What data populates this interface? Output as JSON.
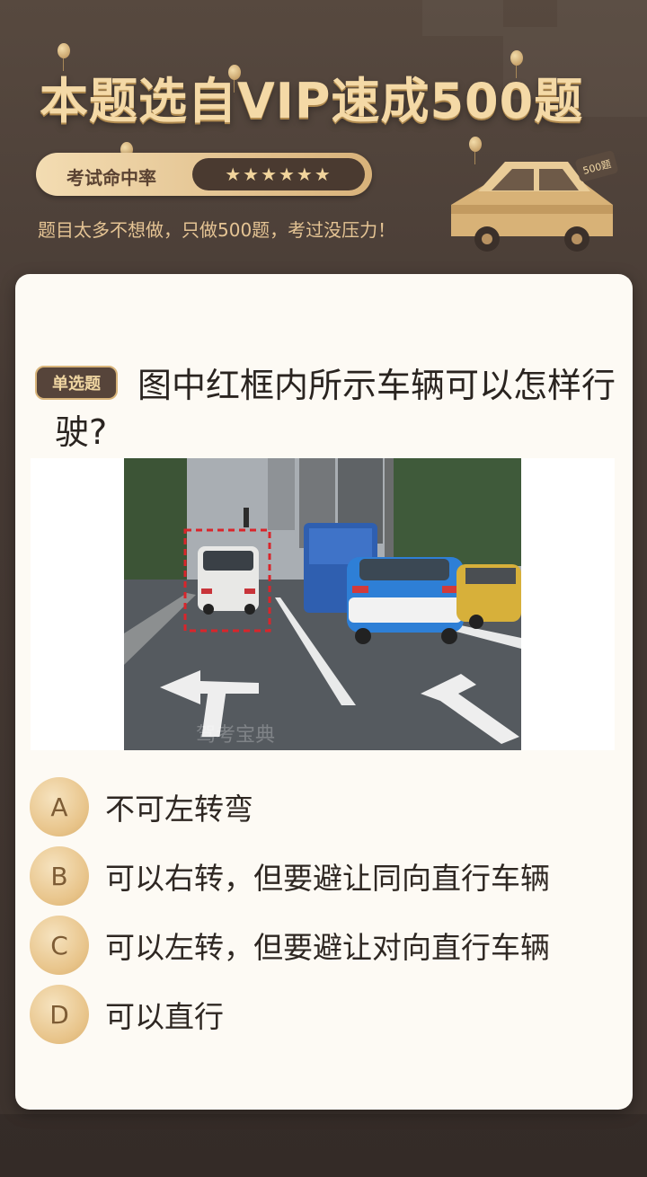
{
  "header": {
    "title": "本题选自VIP速成500题",
    "rate_label": "考试命中率",
    "rate_stars": "★★★★★★",
    "subtitle": "题目太多不想做，只做500题，考过没压力！",
    "car_badge": "500题"
  },
  "question": {
    "type_badge": "单选题",
    "text": "图中红框内所示车辆可以怎样行驶?",
    "image_watermark": "驾考宝典"
  },
  "options": [
    {
      "letter": "A",
      "text": "不可左转弯"
    },
    {
      "letter": "B",
      "text": "可以右转，但要避让同向直行车辆"
    },
    {
      "letter": "C",
      "text": "可以左转，但要避让对向直行车辆"
    },
    {
      "letter": "D",
      "text": "可以直行"
    }
  ],
  "colors": {
    "background": "#4a3f3a",
    "gold": "#f4d9a6",
    "card": "#fdfaf4",
    "badge": "#56443a"
  }
}
